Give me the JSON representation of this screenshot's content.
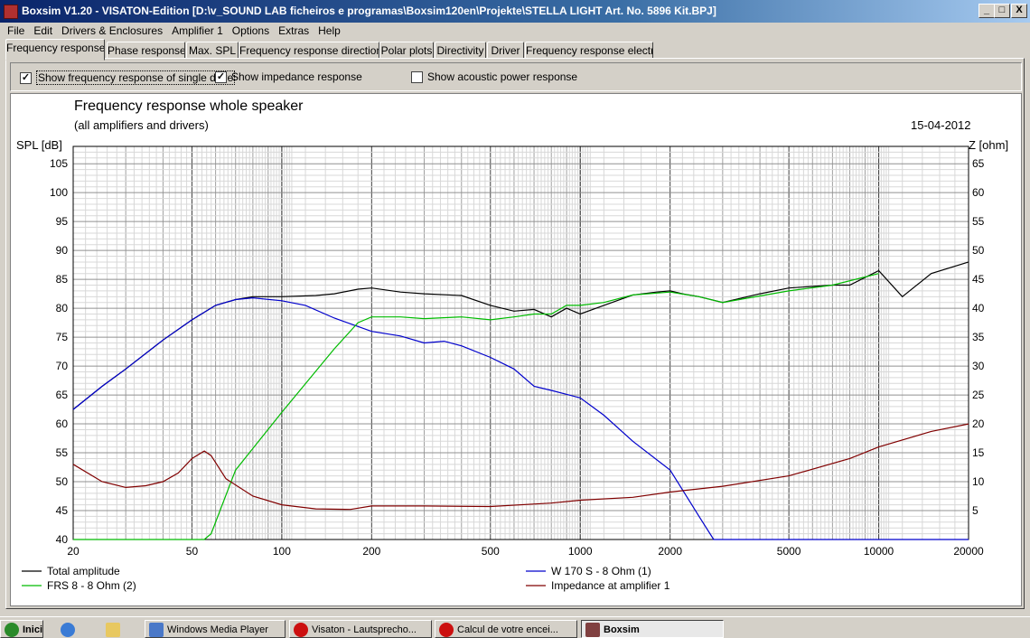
{
  "window": {
    "title": "Boxsim V1.20 - VISATON-Edition [D:\\v_SOUND LAB ficheiros e programas\\Boxsim120en\\Projekte\\STELLA LIGHT Art. No. 5896 Kit.BPJ]",
    "min": "_",
    "max": "□",
    "close": "X"
  },
  "menu": [
    "File",
    "Edit",
    "Drivers & Enclosures",
    "Amplifier 1",
    "Options",
    "Extras",
    "Help"
  ],
  "tabs": [
    "Frequency response.",
    "Phase response",
    "Max. SPL",
    "Frequency response directions",
    "Polar plots",
    "Directivity",
    "Driver",
    "Frequency response electr.."
  ],
  "options": {
    "single_drive": {
      "label": "Show frequency response of single drive",
      "checked": true
    },
    "impedance": {
      "label": "Show impedance response",
      "checked": true
    },
    "acoustic_power": {
      "label": "Show acoustic power response",
      "checked": false
    }
  },
  "plot": {
    "title": "Frequency response whole speaker",
    "subtitle": "(all amplifiers and drivers)",
    "date": "15-04-2012",
    "left_axis_label": "SPL [dB]",
    "right_axis_label": "Z [ohm]"
  },
  "chart_data": {
    "type": "line",
    "x_scale": "log",
    "xlim": [
      20,
      20000
    ],
    "ylim": [
      40,
      108
    ],
    "y2lim": [
      0,
      68
    ],
    "x_ticks": [
      "20",
      "50",
      "100",
      "200",
      "500",
      "1000",
      "2000",
      "5000",
      "10000",
      "20000"
    ],
    "y_ticks": [
      "40",
      "45",
      "50",
      "55",
      "60",
      "65",
      "70",
      "75",
      "80",
      "85",
      "90",
      "95",
      "100",
      "105"
    ],
    "y2_ticks": [
      "5",
      "10",
      "15",
      "20",
      "25",
      "30",
      "35",
      "40",
      "45",
      "50",
      "55",
      "60",
      "65"
    ],
    "grid": true,
    "series": [
      {
        "name": "Total amplitude",
        "color": "#000000",
        "axis": "left",
        "x": [
          20,
          25,
          30,
          40,
          50,
          60,
          70,
          80,
          100,
          130,
          150,
          180,
          200,
          250,
          300,
          400,
          500,
          600,
          700,
          800,
          900,
          1000,
          1200,
          1500,
          1800,
          2000,
          2200,
          2500,
          3000,
          4000,
          5000,
          7000,
          8000,
          10000,
          12000,
          15000,
          20000
        ],
        "y": [
          62.5,
          66.5,
          69.5,
          74.5,
          78,
          80.5,
          81.5,
          82,
          82,
          82.2,
          82.5,
          83.3,
          83.5,
          82.8,
          82.5,
          82.2,
          80.5,
          79.5,
          79.8,
          78.5,
          80,
          79,
          80.5,
          82.3,
          82.8,
          83,
          82.5,
          82,
          81,
          82.5,
          83.5,
          84,
          84,
          86.5,
          82,
          86,
          88
        ]
      },
      {
        "name": "W 170 S - 8 Ohm (1)",
        "color": "#0000cc",
        "axis": "left",
        "x": [
          20,
          25,
          30,
          40,
          50,
          60,
          70,
          80,
          100,
          120,
          150,
          200,
          250,
          300,
          350,
          400,
          500,
          600,
          700,
          800,
          1000,
          1200,
          1500,
          2000,
          2500,
          2800,
          3000,
          5000,
          20000
        ],
        "y": [
          62.5,
          66.5,
          69.5,
          74.5,
          78,
          80.5,
          81.5,
          81.8,
          81.3,
          80.5,
          78.3,
          76,
          75.2,
          74,
          74.3,
          73.5,
          71.5,
          69.5,
          66.5,
          65.8,
          64.5,
          61.5,
          57,
          52,
          44,
          40,
          40,
          40,
          40
        ]
      },
      {
        "name": "FRS 8 - 8 Ohm (2)",
        "color": "#00bb00",
        "axis": "left",
        "x": [
          20,
          40,
          55,
          58,
          70,
          100,
          150,
          180,
          200,
          250,
          300,
          400,
          500,
          600,
          700,
          800,
          900,
          1000,
          1200,
          1500,
          2000,
          2500,
          3000,
          5000,
          7000,
          10000
        ],
        "y": [
          40,
          40,
          40,
          41,
          52,
          62,
          73,
          77.5,
          78.5,
          78.5,
          78.2,
          78.5,
          78,
          78.5,
          79,
          79,
          80.5,
          80.5,
          81,
          82.3,
          82.8,
          82,
          81,
          83,
          84,
          86
        ]
      },
      {
        "name": "Impedance at amplifier 1",
        "color": "#800000",
        "axis": "right",
        "x": [
          20,
          25,
          30,
          35,
          40,
          45,
          50,
          55,
          58,
          65,
          80,
          100,
          130,
          170,
          200,
          300,
          500,
          800,
          1000,
          1500,
          2000,
          3000,
          5000,
          8000,
          10000,
          15000,
          20000
        ],
        "y": [
          13,
          10,
          9,
          9.3,
          10,
          11.5,
          14,
          15.3,
          14.5,
          10.5,
          7.5,
          6,
          5.3,
          5.2,
          5.8,
          5.8,
          5.7,
          6.3,
          6.8,
          7.3,
          8.2,
          9.2,
          11,
          14,
          16,
          18.7,
          20
        ]
      }
    ]
  },
  "taskbar": [
    {
      "label": "Iniciar",
      "icon": "windows-icon"
    },
    {
      "label": "",
      "icon": "ie-icon"
    },
    {
      "label": "",
      "icon": "folder-icon"
    },
    {
      "label": "Windows Media Player",
      "icon": "media-player-icon"
    },
    {
      "label": "Visaton - Lautsprecho...",
      "icon": "opera-icon"
    },
    {
      "label": "Calcul de votre encei...",
      "icon": "opera-icon"
    },
    {
      "label": "Boxsim",
      "icon": "boxsim-icon",
      "active": true
    }
  ]
}
